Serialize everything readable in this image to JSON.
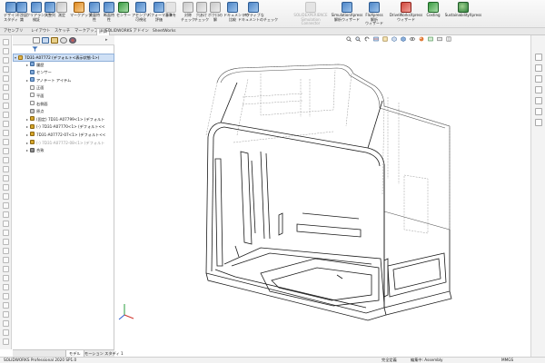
{
  "ribbon": {
    "buttons": [
      {
        "label": "デザイン\nスタディ",
        "icon": "design-study-icon"
      },
      {
        "label": "干渉認\n識",
        "icon": "interference-detection-icon"
      },
      {
        "label": "クリアランス\n検証",
        "icon": "clearance-verification-icon"
      },
      {
        "label": "穴整列\n",
        "icon": "hole-alignment-icon"
      },
      {
        "label": "測定\n",
        "icon": "measure-icon"
      },
      {
        "label": "マークアップ\n",
        "icon": "markup-icon"
      },
      {
        "label": "質量特\n性",
        "icon": "mass-properties-icon"
      },
      {
        "label": "断面特\n性",
        "icon": "section-properties-icon"
      },
      {
        "label": "センサー\n",
        "icon": "sensor-icon"
      },
      {
        "label": "アセンブリ\n可視化",
        "icon": "assembly-visualization-icon"
      },
      {
        "label": "パフォーマンス\n評価",
        "icon": "performance-evaluation-icon"
      },
      {
        "label": "基準を\n",
        "icon": "reference-icon"
      },
      {
        "label": "対称\nチェック",
        "icon": "symmetry-check-icon"
      },
      {
        "label": "穴あけ\nチェック",
        "icon": "hole-check-icon"
      },
      {
        "label": "ボク口の\n解",
        "icon": "bolt-hole-icon"
      },
      {
        "label": "ドキュメントの\n比較",
        "icon": "compare-documents-icon"
      },
      {
        "label": "アクティブな\nドキュメントのチェック",
        "icon": "check-active-document-icon"
      },
      {
        "label": "SOLIDEXPERIENCE\nSimulation\nConnector",
        "icon": "simulation-connector-icon",
        "disabled": true
      },
      {
        "label": "SimulationXpress\n解析ウィザード",
        "icon": "simulationxpress-icon"
      },
      {
        "label": "FloXpress\n解析\nウィザード",
        "icon": "floxpress-icon"
      },
      {
        "label": "DriveWorksXpress\nウィザード",
        "icon": "driveworksxpress-icon"
      },
      {
        "label": "Costing",
        "icon": "costing-icon"
      },
      {
        "label": "SustainabilityXpress",
        "icon": "sustainabilityxpress-icon"
      }
    ]
  },
  "command_tabs": [
    "アセンブリ",
    "レイアウト",
    "スケッチ",
    "マークアップ",
    "評価",
    "SOLIDWORKS アドイン",
    "SheetWorks"
  ],
  "active_command_tab": "評価",
  "tree": {
    "root": "7D31-A07772 (デフォルト<表示状態-1>)",
    "rows": [
      {
        "label": "履歴",
        "icon": "history-icon",
        "indent": 1,
        "expand": "▸"
      },
      {
        "label": "センサー",
        "icon": "sensors-icon",
        "indent": 1,
        "expand": ""
      },
      {
        "label": "アノテート アイテム",
        "icon": "annotations-icon",
        "indent": 1,
        "expand": "▸"
      },
      {
        "label": "正面",
        "icon": "plane-icon",
        "indent": 1,
        "expand": ""
      },
      {
        "label": "平面",
        "icon": "plane-icon",
        "indent": 1,
        "expand": ""
      },
      {
        "label": "右側面",
        "icon": "plane-icon",
        "indent": 1,
        "expand": ""
      },
      {
        "label": "原点",
        "icon": "origin-icon",
        "indent": 1,
        "expand": ""
      },
      {
        "label": "(固定) 7D31-A07799<1> (デフォルト",
        "icon": "part-icon",
        "indent": 1,
        "expand": "▸"
      },
      {
        "label": "(-) 7D31-A07770<1> (デフォルト<<",
        "icon": "part-icon",
        "indent": 1,
        "expand": "▸"
      },
      {
        "label": "7D31-A07772-07<1> (デフォルト<<",
        "icon": "part-icon",
        "indent": 1,
        "expand": "▸"
      },
      {
        "label": "(-) 7D31-A07772-08<1> (デフォルト",
        "icon": "part-icon",
        "indent": 1,
        "expand": "▸",
        "muted": true
      },
      {
        "label": "合致",
        "icon": "mates-icon",
        "indent": 1,
        "expand": "▸"
      }
    ]
  },
  "bottom_tabs": [
    "モデル",
    "モーション スタディ 1"
  ],
  "active_bottom_tab": "モデル",
  "status": {
    "app": "SOLIDWORKS Professional 2020 SP1.0",
    "state": "完全定義",
    "mode": "編集中: Assembly",
    "units": "MMGS"
  },
  "colors": {
    "ribbon_accent": "#3b6fb6",
    "selection": "#cfe0f5",
    "model_line": "#1a1a1a",
    "hidden_line": "#9a9a9a"
  }
}
